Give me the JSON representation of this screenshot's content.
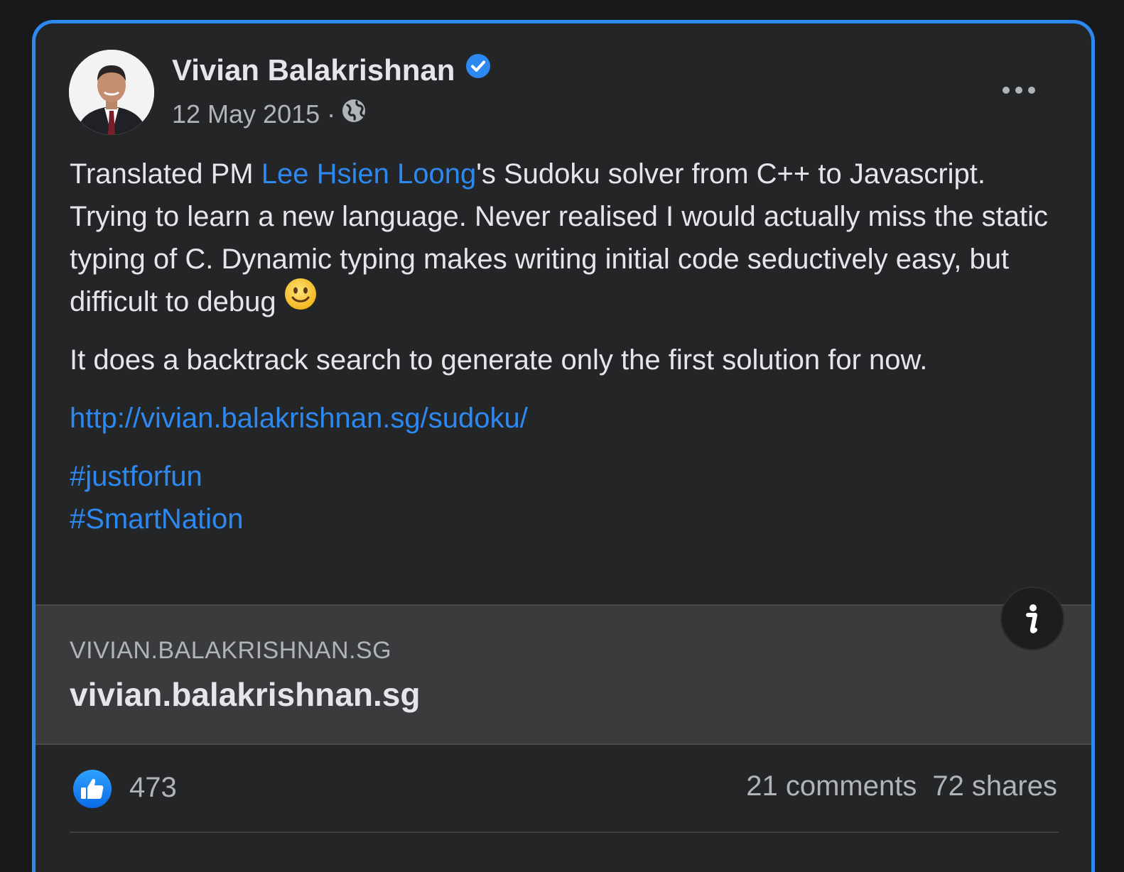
{
  "post": {
    "author": "Vivian Balakrishnan",
    "date": "12 May 2015",
    "separator": "·",
    "icons": {
      "verified": "verified-badge-icon",
      "privacy": "globe-icon",
      "more": "more-options-icon",
      "emoji": "slightly-smiling-face"
    },
    "paragraph1": {
      "prefix": "Translated PM ",
      "mention": "Lee Hsien Loong",
      "suffix": "'s Sudoku solver from C++ to Javascript. Trying to learn a new language. Never realised I would actually miss the static typing of C. Dynamic typing makes writing initial code seductively easy, but difficult to debug"
    },
    "paragraph2": "It does a backtrack search to generate only the first solution for now.",
    "link": "http://vivian.balakrishnan.sg/sudoku/",
    "hashtags": [
      "#justforfun",
      "#SmartNation"
    ]
  },
  "preview": {
    "domain": "VIVIAN.BALAKRISHNAN.SG",
    "title": "vivian.balakrishnan.sg",
    "info_icon": "info-icon"
  },
  "stats": {
    "likes": "473",
    "comments": "21 comments",
    "shares": "72 shares"
  },
  "colors": {
    "accent": "#2d88f0",
    "card_bg": "#242527",
    "preview_bg": "#3a3b3c",
    "text_primary": "#e4e6eb",
    "text_secondary": "#b0b3b8"
  }
}
